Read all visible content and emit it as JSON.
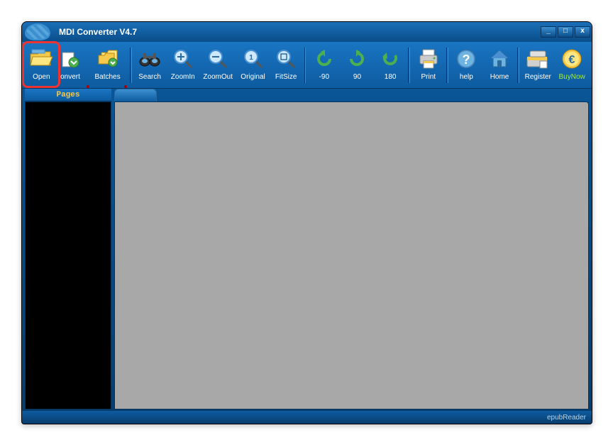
{
  "title": "MDI Converter V4.7",
  "window": {
    "min": "_",
    "max": "□",
    "close": "x"
  },
  "toolbar": {
    "open": "Open",
    "convert": "onvert",
    "batches": "Batches",
    "search": "Search",
    "zoomin": "ZoomIn",
    "zoomout": "ZoomOut",
    "original": "Original",
    "fitsize": "FitSize",
    "rot_neg90": "-90",
    "rot_90": "90",
    "rot_180": "180",
    "print": "Print",
    "help": "help",
    "home": "Home",
    "register": "Register",
    "buynow": "BuyNow"
  },
  "sidebar": {
    "pages_label": "Pages"
  },
  "statusbar": {
    "right": "epubReader"
  }
}
